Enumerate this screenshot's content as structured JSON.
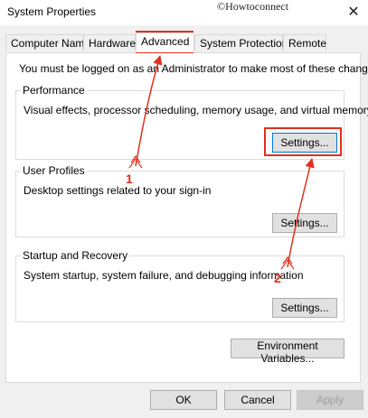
{
  "window": {
    "title": "System Properties",
    "watermark": "©Howtoconnect",
    "close_glyph": "✕"
  },
  "tabs": [
    {
      "label": "Computer Name"
    },
    {
      "label": "Hardware"
    },
    {
      "label": "Advanced"
    },
    {
      "label": "System Protection"
    },
    {
      "label": "Remote"
    }
  ],
  "panel": {
    "notice": "You must be logged on as an Administrator to make most of these changes.",
    "performance": {
      "title": "Performance",
      "description": "Visual effects, processor scheduling, memory usage, and virtual memory",
      "button": "Settings..."
    },
    "user_profiles": {
      "title": "User Profiles",
      "description": "Desktop settings related to your sign-in",
      "button": "Settings..."
    },
    "startup_recovery": {
      "title": "Startup and Recovery",
      "description": "System startup, system failure, and debugging information",
      "button": "Settings..."
    },
    "env_button": "Environment Variables..."
  },
  "footer": {
    "ok": "OK",
    "cancel": "Cancel",
    "apply": "Apply"
  },
  "annotations": {
    "marker_1": "1",
    "marker_2": "2",
    "color": "#e0301e"
  }
}
